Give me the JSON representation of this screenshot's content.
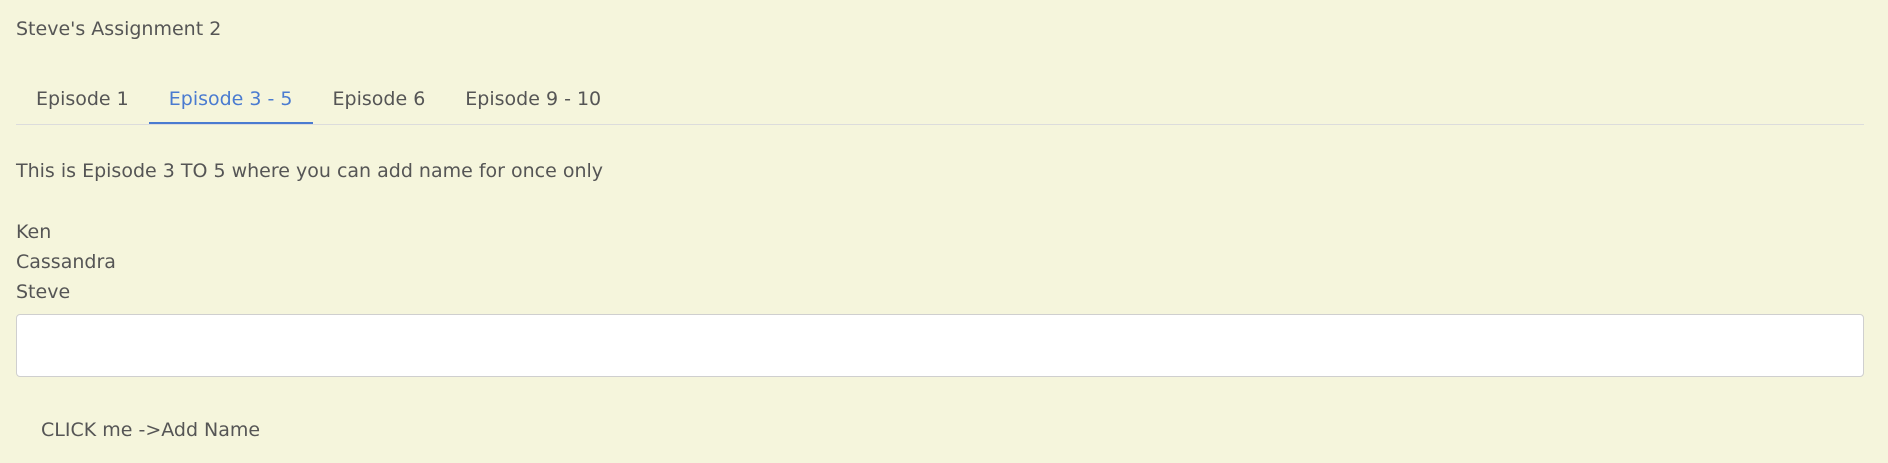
{
  "app": {
    "title": "Steve's Assignment 2"
  },
  "tabs": [
    {
      "label": "Episode 1",
      "active": false
    },
    {
      "label": "Episode 3 - 5",
      "active": true
    },
    {
      "label": "Episode 6",
      "active": false
    },
    {
      "label": "Episode 9 - 10",
      "active": false
    }
  ],
  "main": {
    "description": "This is Episode 3 TO 5 where you can add name for once only",
    "names": [
      "Ken",
      "Cassandra",
      "Steve"
    ],
    "input": {
      "value": "",
      "placeholder": ""
    },
    "add_button_label": "CLICK me ->Add Name"
  },
  "colors": {
    "background": "#f5f5dc",
    "text": "#555555",
    "accent": "#4a7bd0",
    "input_background": "#ffffff",
    "divider": "#dcdcdc"
  }
}
